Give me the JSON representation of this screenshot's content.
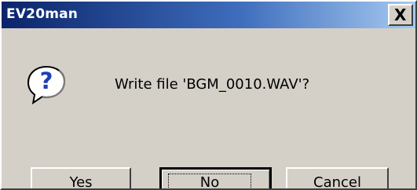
{
  "window": {
    "title": "EV20man",
    "close_glyph": "X"
  },
  "message": {
    "text": "Write file 'BGM_0010.WAV'?"
  },
  "buttons": {
    "yes": {
      "mnemonic": "Y",
      "rest": "es"
    },
    "no": {
      "mnemonic": "N",
      "rest": "o"
    },
    "cancel": {
      "label": "Cancel"
    }
  },
  "icons": {
    "dialog": "question-icon"
  },
  "colors": {
    "title_start": "#0a246a",
    "title_end": "#a6caf0",
    "face": "#d4d0c8",
    "question_blue": "#1f3fb8"
  }
}
